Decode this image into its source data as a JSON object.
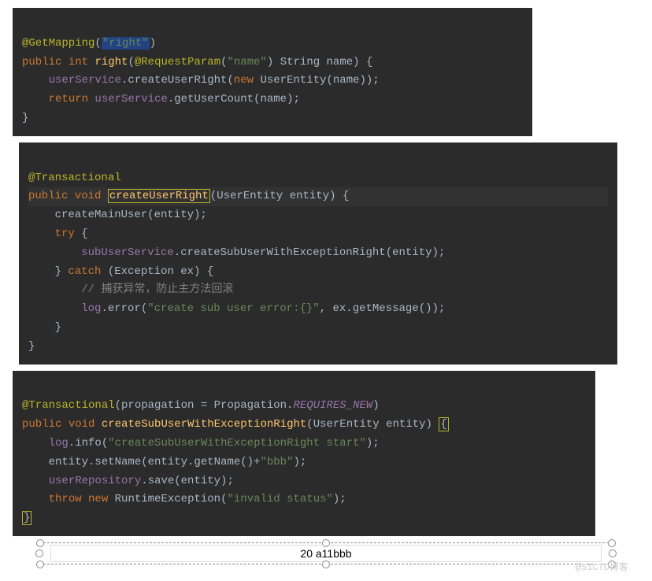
{
  "block1": {
    "l1_ann": "@GetMapping",
    "l1_paren_open": "(",
    "l1_str": "\"right\"",
    "l1_paren_close": ")",
    "l2_kw1": "public",
    "l2_kw2": "int",
    "l2_fn": "right",
    "l2_sig1": "(",
    "l2_ann": "@RequestParam",
    "l2_sig2": "(",
    "l2_str": "\"name\"",
    "l2_sig3": ") String name) {",
    "l3_obj": "userService",
    "l3_dot": ".createUserRight(",
    "l3_kw": "new",
    "l3_rest": " UserEntity(name));",
    "l4_kw": "return",
    "l4_obj": " userService",
    "l4_rest": ".getUserCount(name);",
    "l5": "}"
  },
  "block2": {
    "l1": "@Transactional",
    "l2_kw1": "public",
    "l2_kw2": "void",
    "l2_fn": "createUserRight",
    "l2_rest": "(UserEntity entity) {",
    "l3": "    createMainUser(entity);",
    "l4_kw": "try",
    "l4_rest": " {",
    "l5_obj": "subUserService",
    "l5_rest": ".createSubUserWithExceptionRight(entity);",
    "l6_close": "    } ",
    "l6_kw": "catch",
    "l6_rest": " (Exception ex) {",
    "l7_comment": "// 捕获异常，防止主方法回滚",
    "l8_obj": "log",
    "l8_call": ".error(",
    "l8_str": "\"create sub user error:{}\"",
    "l8_rest": ", ex.getMessage());",
    "l9": "    }",
    "l10": "}"
  },
  "block3": {
    "l1_ann": "@Transactional",
    "l1_p1": "(propagation = Propagation.",
    "l1_const": "REQUIRES_NEW",
    "l1_p2": ")",
    "l2_kw1": "public",
    "l2_kw2": "void",
    "l2_fn": "createSubUserWithExceptionRight",
    "l2_sig": "(UserEntity entity) ",
    "l2_brace": "{",
    "l3_obj": "log",
    "l3_call": ".info(",
    "l3_str": "\"createSubUserWithExceptionRight start\"",
    "l3_rest": ");",
    "l4_p1": "    entity.setName(entity.getName()+",
    "l4_str": "\"bbb\"",
    "l4_p2": ");",
    "l5_obj": "userRepository",
    "l5_rest": ".save(entity);",
    "l6_kw1": "throw",
    "l6_kw2": "new",
    "l6_cls": " RuntimeException(",
    "l6_str": "\"invalid status\"",
    "l6_rest": ");",
    "l7": "}"
  },
  "result": "20 a11bbb",
  "watermark": "@51CTO博客"
}
